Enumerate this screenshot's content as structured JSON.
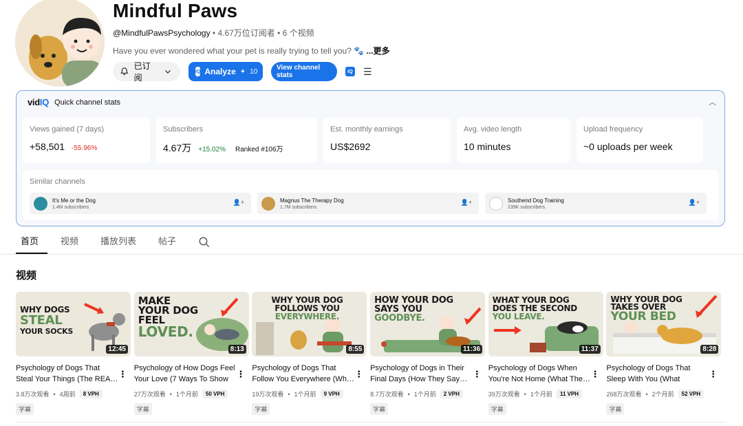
{
  "channel": {
    "title": "Mindful Paws",
    "handle": "@MindfulPawsPsychology",
    "meta": " • 4.67万位订阅者 • 6 个视频",
    "description": "Have you ever wondered what your pet is really trying to tell you? 🐾",
    "more": " ...更多",
    "subscribed_label": "已订阅",
    "analyze_label": "Analyze",
    "analyze_count": "10",
    "view_stats_label": "View channel stats"
  },
  "vidiq": {
    "logo_prefix": "vid",
    "logo_suffix": "IQ",
    "panel_title": "Quick channel stats",
    "stats": [
      {
        "label": "Views gained (7 days)",
        "value": "+58,501",
        "change": "-55.96%"
      },
      {
        "label": "Subscribers",
        "value": "4.67万",
        "change": "+15.02%",
        "rank": "Ranked #106万"
      },
      {
        "label": "Est. monthly earnings",
        "value": "US$2692"
      },
      {
        "label": "Avg. video length",
        "value": "10 minutes"
      },
      {
        "label": "Upload frequency",
        "value": "~0 uploads per week"
      }
    ],
    "similar_label": "Similar channels",
    "similar": [
      {
        "name": "It's Me or the Dog",
        "subs": "1.4M subscribers"
      },
      {
        "name": "Magnus The Therapy Dog",
        "subs": "1.7M subscribers"
      },
      {
        "name": "Southend Dog Training",
        "subs": "239K subscribers"
      }
    ]
  },
  "tabs": [
    "首页",
    "视频",
    "播放列表",
    "帖子"
  ],
  "section_title": "视频",
  "videos": [
    {
      "thumb_text": "WHY DOGS STEAL YOUR SOCKS",
      "duration": "12:45",
      "title": "Psychology of Dogs That Steal Your Things (The REA…",
      "views": "3.8万次观看",
      "age": "4周前",
      "vph": "8 VPH",
      "cc": "字幕"
    },
    {
      "thumb_text": "MAKE YOUR DOG FEEL LOVED.",
      "duration": "8:13",
      "title": "Psychology of How Dogs Feel Your Love (7 Ways To Show …",
      "views": "27万次观看",
      "age": "1个月前",
      "vph": "50 VPH",
      "cc": "字幕"
    },
    {
      "thumb_text": "WHY YOUR DOG FOLLOWS YOU EVERYWHERE.",
      "duration": "8:55",
      "title": "Psychology of Dogs That Follow You Everywhere (Wh…",
      "views": "19万次观看",
      "age": "1个月前",
      "vph": "9 VPH",
      "cc": "字幕"
    },
    {
      "thumb_text": "HOW YOUR DOG SAYS YOU GOODBYE.",
      "duration": "11:36",
      "title": "Psychology of Dogs in Their Final Days (How They Say…",
      "views": "8.7万次观看",
      "age": "1个月前",
      "vph": "2 VPH",
      "cc": "字幕"
    },
    {
      "thumb_text": "WHAT YOUR DOG DOES THE SECOND YOU LEAVE.",
      "duration": "11:37",
      "title": "Psychology of Dogs When You're Not Home (What The…",
      "views": "39万次观看",
      "age": "1个月前",
      "vph": "11 VPH",
      "cc": "字幕"
    },
    {
      "thumb_text": "WHY YOUR DOG TAKES OVER YOUR BED",
      "duration": "8:28",
      "title": "Psychology of Dogs That Sleep With You (What They'r…",
      "views": "268万次观看",
      "age": "2个月前",
      "vph": "52 VPH",
      "cc": "字幕"
    }
  ],
  "colors": {
    "accent": "#1a73e8",
    "negative": "#d93025",
    "positive": "#188038",
    "panel_border": "#7fa8e8"
  }
}
